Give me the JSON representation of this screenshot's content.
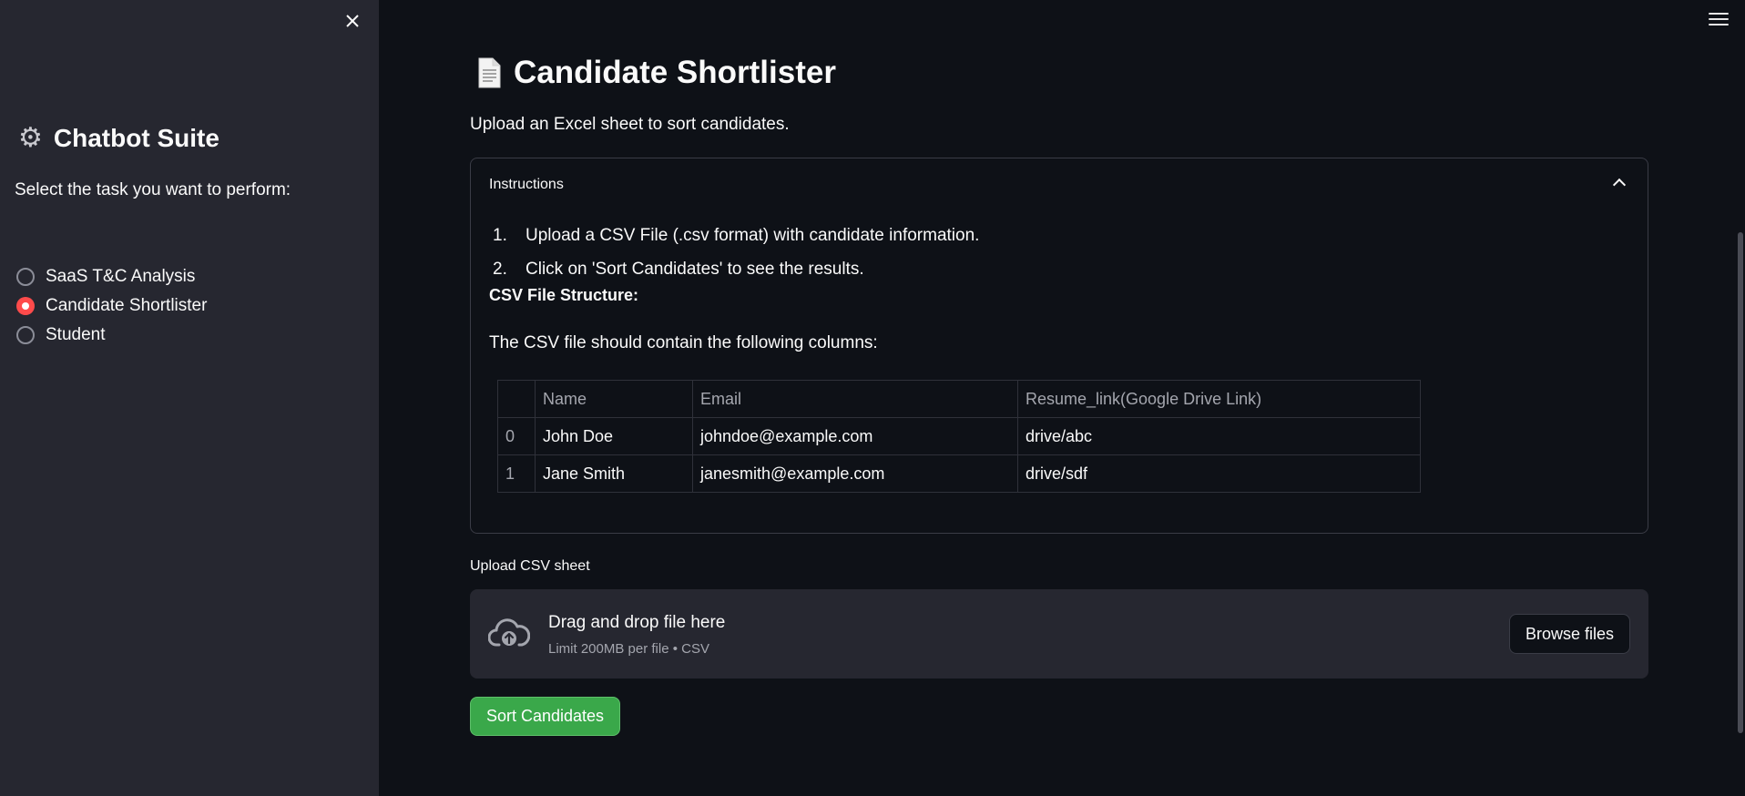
{
  "sidebar": {
    "title": "Chatbot Suite",
    "subtitle": "Select the task you want to perform:",
    "options": [
      {
        "label": "SaaS T&C Analysis",
        "selected": false
      },
      {
        "label": "Candidate Shortlister",
        "selected": true
      },
      {
        "label": "Student",
        "selected": false
      }
    ]
  },
  "main": {
    "title": "Candidate Shortlister",
    "description": "Upload an Excel sheet to sort candidates.",
    "instructions": {
      "label": "Instructions",
      "steps": [
        {
          "num": "1.",
          "text": "Upload a CSV File (.csv format) with candidate information."
        },
        {
          "num": "2.",
          "text": "Click on 'Sort Candidates' to see the results."
        }
      ],
      "csv_heading": "CSV File Structure:",
      "csv_description": "The CSV file should contain the following columns:",
      "table": {
        "headers": [
          "",
          "Name",
          "Email",
          "Resume_link(Google Drive Link)"
        ],
        "rows": [
          [
            "0",
            "John Doe",
            "johndoe@example.com",
            "drive/abc"
          ],
          [
            "1",
            "Jane Smith",
            "janesmith@example.com",
            "drive/sdf"
          ]
        ]
      }
    },
    "upload": {
      "label": "Upload CSV sheet",
      "drop_title": "Drag and drop file here",
      "drop_limit": "Limit 200MB per file • CSV",
      "browse_label": "Browse files"
    },
    "sort_button": "Sort Candidates"
  },
  "colors": {
    "background": "#0e1117",
    "sidebar": "#262730",
    "accent_red": "#ff4b4b",
    "button_green": "#3aa84a"
  },
  "icons": {
    "close": "close-icon",
    "gear": "gear-icon",
    "document": "document-icon",
    "cloud_upload": "cloud-upload-icon",
    "menu": "hamburger-menu-icon",
    "chevron": "chevron-up-icon"
  }
}
